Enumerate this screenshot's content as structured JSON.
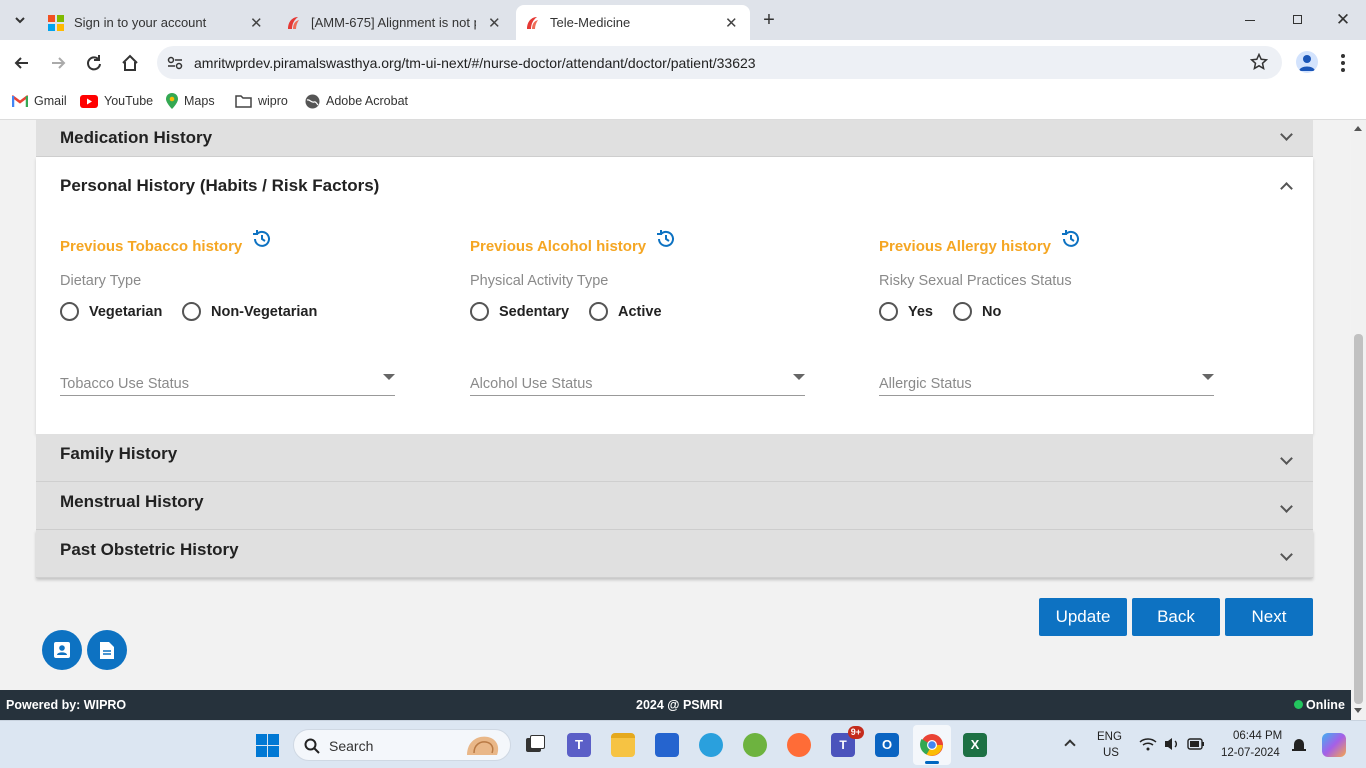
{
  "browser": {
    "tabs": [
      {
        "title": "Sign in to your account"
      },
      {
        "title": "[AMM-675] Alignment is not pr"
      },
      {
        "title": "Tele-Medicine"
      }
    ],
    "url": "amritwprdev.piramalswasthya.org/tm-ui-next/#/nurse-doctor/attendant/doctor/patient/33623",
    "bookmarks": [
      "Gmail",
      "YouTube",
      "Maps",
      "wipro",
      "Adobe Acrobat"
    ]
  },
  "panels": {
    "medication": "Medication History",
    "personal": "Personal History (Habits / Risk Factors)",
    "family": "Family History",
    "menstrual": "Menstrual History",
    "obstetric": "Past Obstetric History"
  },
  "personal": {
    "tobacco_link": "Previous Tobacco history",
    "alcohol_link": "Previous Alcohol history",
    "allergy_link": "Previous Allergy history",
    "dietary_label": "Dietary Type",
    "dietary_options": [
      "Vegetarian",
      "Non-Vegetarian"
    ],
    "physical_label": "Physical Activity Type",
    "physical_options": [
      "Sedentary",
      "Active"
    ],
    "risky_label": "Risky Sexual Practices Status",
    "risky_options": [
      "Yes",
      "No"
    ],
    "tobacco_select": "Tobacco Use Status",
    "alcohol_select": "Alcohol Use Status",
    "allergic_select": "Allergic Status"
  },
  "actions": {
    "update": "Update",
    "back": "Back",
    "next": "Next"
  },
  "footer": {
    "left": "Powered by: WIPRO",
    "center": "2024 @ PSMRI",
    "status": "Online"
  },
  "taskbar": {
    "search": "Search",
    "lang": "ENG",
    "region": "US",
    "time": "06:44 PM",
    "date": "12-07-2024",
    "teams_badge": "9+"
  },
  "colors": {
    "accent": "#0d72c2",
    "link": "#f5a623",
    "online": "#22c55e"
  }
}
